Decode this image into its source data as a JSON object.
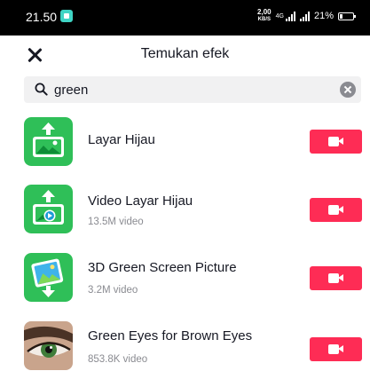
{
  "status_bar": {
    "time": "21.50",
    "network_speed_value": "2,00",
    "network_speed_unit": "KB/S",
    "network_type": "4G",
    "battery": "21%"
  },
  "sheet": {
    "title": "Temukan efek",
    "close_icon": "close-icon"
  },
  "search": {
    "value": "green",
    "search_icon": "search-icon",
    "clear_icon": "clear-icon"
  },
  "effects": [
    {
      "name": "Layar Hijau",
      "count": "",
      "icon": "green-screen-photo-icon",
      "button_icon": "video-camera-icon"
    },
    {
      "name": "Video Layar Hijau",
      "count": "13.5M video",
      "icon": "green-screen-video-icon",
      "button_icon": "video-camera-icon"
    },
    {
      "name": "3D Green Screen Picture",
      "count": "3.2M video",
      "icon": "3d-green-screen-picture-icon",
      "button_icon": "video-camera-icon"
    },
    {
      "name": "Green Eyes for Brown Eyes",
      "count": "853.8K video",
      "icon": "eye-thumbnail",
      "button_icon": "video-camera-icon"
    }
  ],
  "colors": {
    "record_button": "#fe2c55",
    "icon_green": "#2fbf58",
    "status_bar": "#000000",
    "search_bg": "#f1f1f2",
    "secondary_text": "#8a8b91"
  }
}
